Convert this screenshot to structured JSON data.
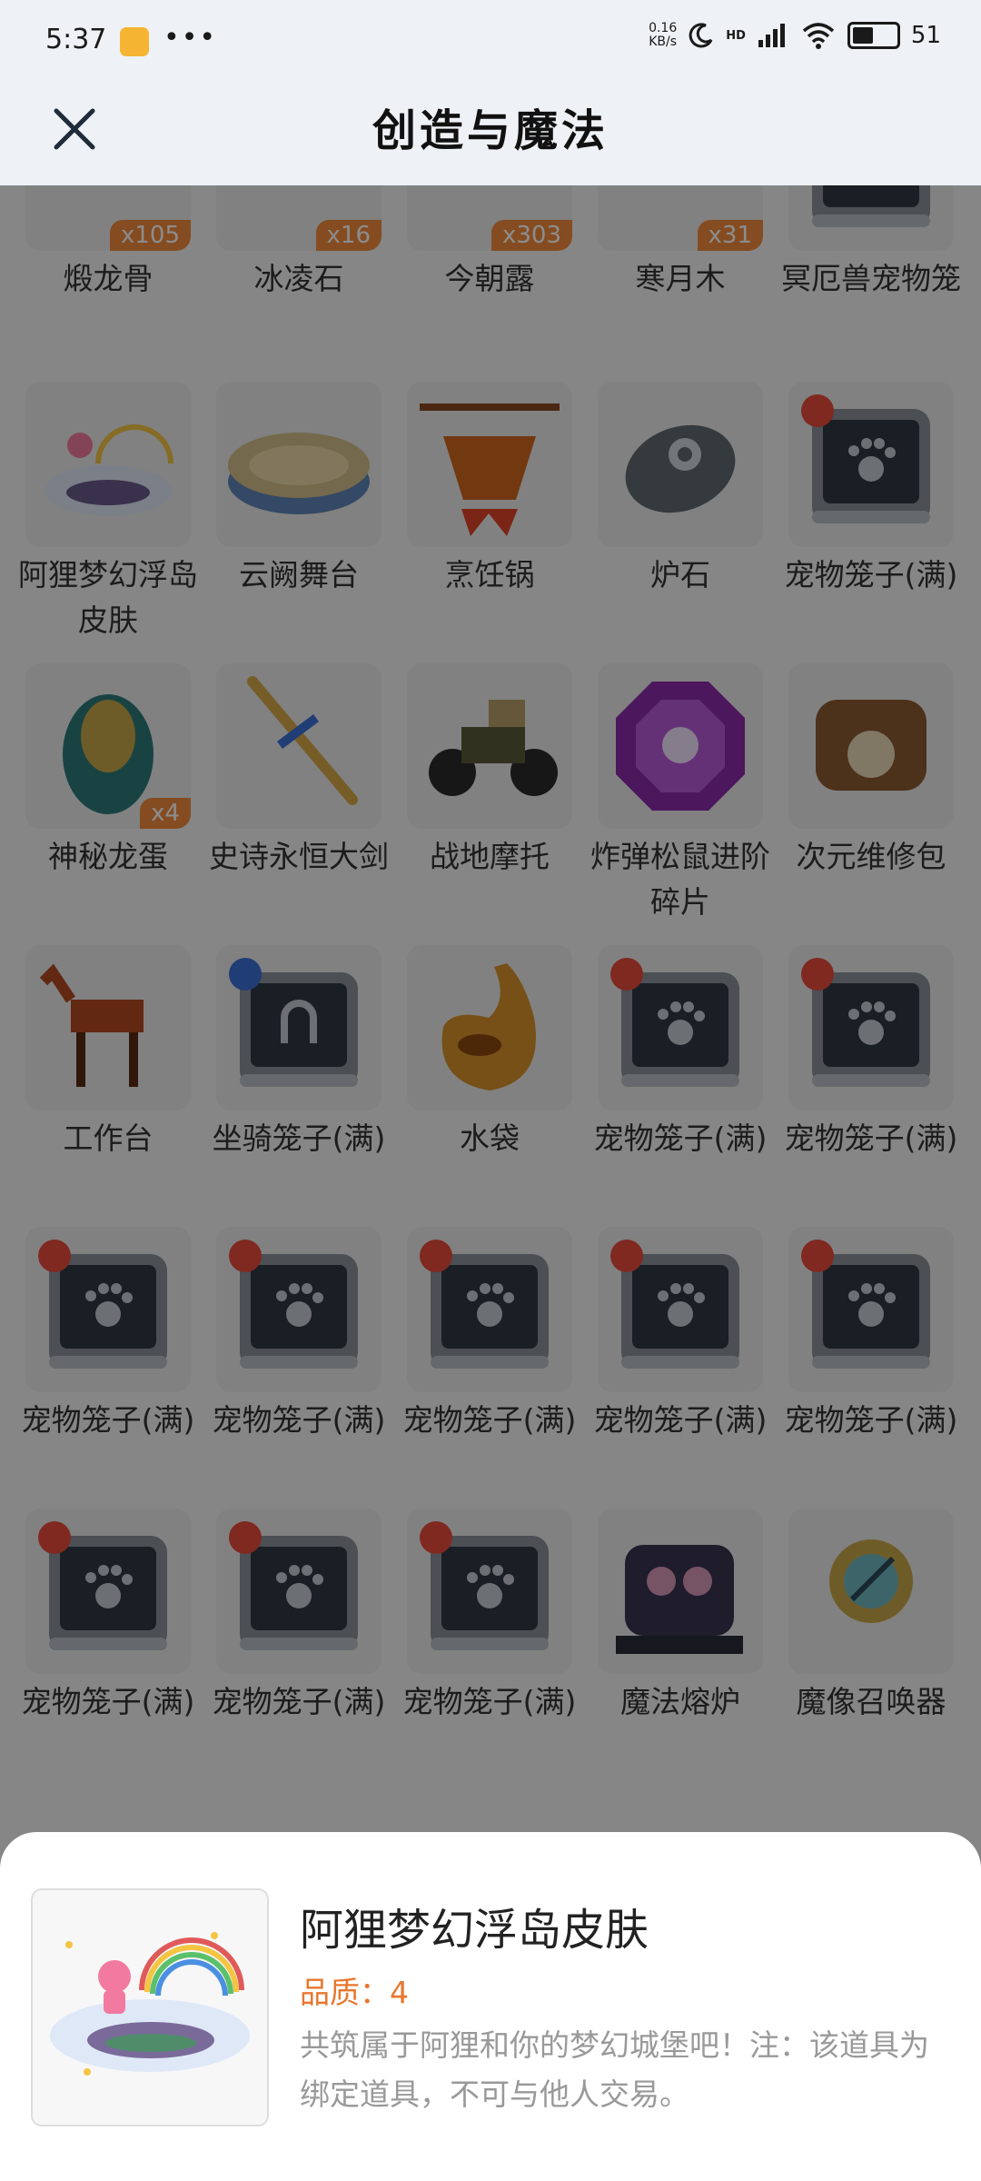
{
  "status_bar": {
    "time": "5:37",
    "more": "•••",
    "netspeed_value": "0.16",
    "netspeed_unit": "KB/s",
    "network": "HD",
    "battery": "51"
  },
  "header": {
    "title": "创造与魔法"
  },
  "items": [
    {
      "name": "煅龙骨",
      "badge": "x105"
    },
    {
      "name": "冰凌石",
      "badge": "x16"
    },
    {
      "name": "今朝露",
      "badge": "x303"
    },
    {
      "name": "寒月木",
      "badge": "x31"
    },
    {
      "name": "冥厄兽宠物笼",
      "badge": ""
    },
    {
      "name": "阿狸梦幻浮岛皮肤",
      "badge": ""
    },
    {
      "name": "云阙舞台",
      "badge": ""
    },
    {
      "name": "烹饪锅",
      "badge": ""
    },
    {
      "name": "炉石",
      "badge": ""
    },
    {
      "name": "宠物笼子(满)",
      "badge": ""
    },
    {
      "name": "神秘龙蛋",
      "badge": "x4"
    },
    {
      "name": "史诗永恒大剑",
      "badge": ""
    },
    {
      "name": "战地摩托",
      "badge": ""
    },
    {
      "name": "炸弹松鼠进阶碎片",
      "badge": ""
    },
    {
      "name": "次元维修包",
      "badge": ""
    },
    {
      "name": "工作台",
      "badge": ""
    },
    {
      "name": "坐骑笼子(满)",
      "badge": ""
    },
    {
      "name": "水袋",
      "badge": ""
    },
    {
      "name": "宠物笼子(满)",
      "badge": ""
    },
    {
      "name": "宠物笼子(满)",
      "badge": ""
    },
    {
      "name": "宠物笼子(满)",
      "badge": ""
    },
    {
      "name": "宠物笼子(满)",
      "badge": ""
    },
    {
      "name": "宠物笼子(满)",
      "badge": ""
    },
    {
      "name": "宠物笼子(满)",
      "badge": ""
    },
    {
      "name": "宠物笼子(满)",
      "badge": ""
    },
    {
      "name": "宠物笼子(满)",
      "badge": ""
    },
    {
      "name": "宠物笼子(满)",
      "badge": ""
    },
    {
      "name": "宠物笼子(满)",
      "badge": ""
    },
    {
      "name": "魔法熔炉",
      "badge": ""
    },
    {
      "name": "魔像召唤器",
      "badge": ""
    }
  ],
  "detail": {
    "title": "阿狸梦幻浮岛皮肤",
    "quality": "品质：4",
    "description": "共筑属于阿狸和你的梦幻城堡吧！注：该道具为绑定道具，不可与他人交易。"
  }
}
